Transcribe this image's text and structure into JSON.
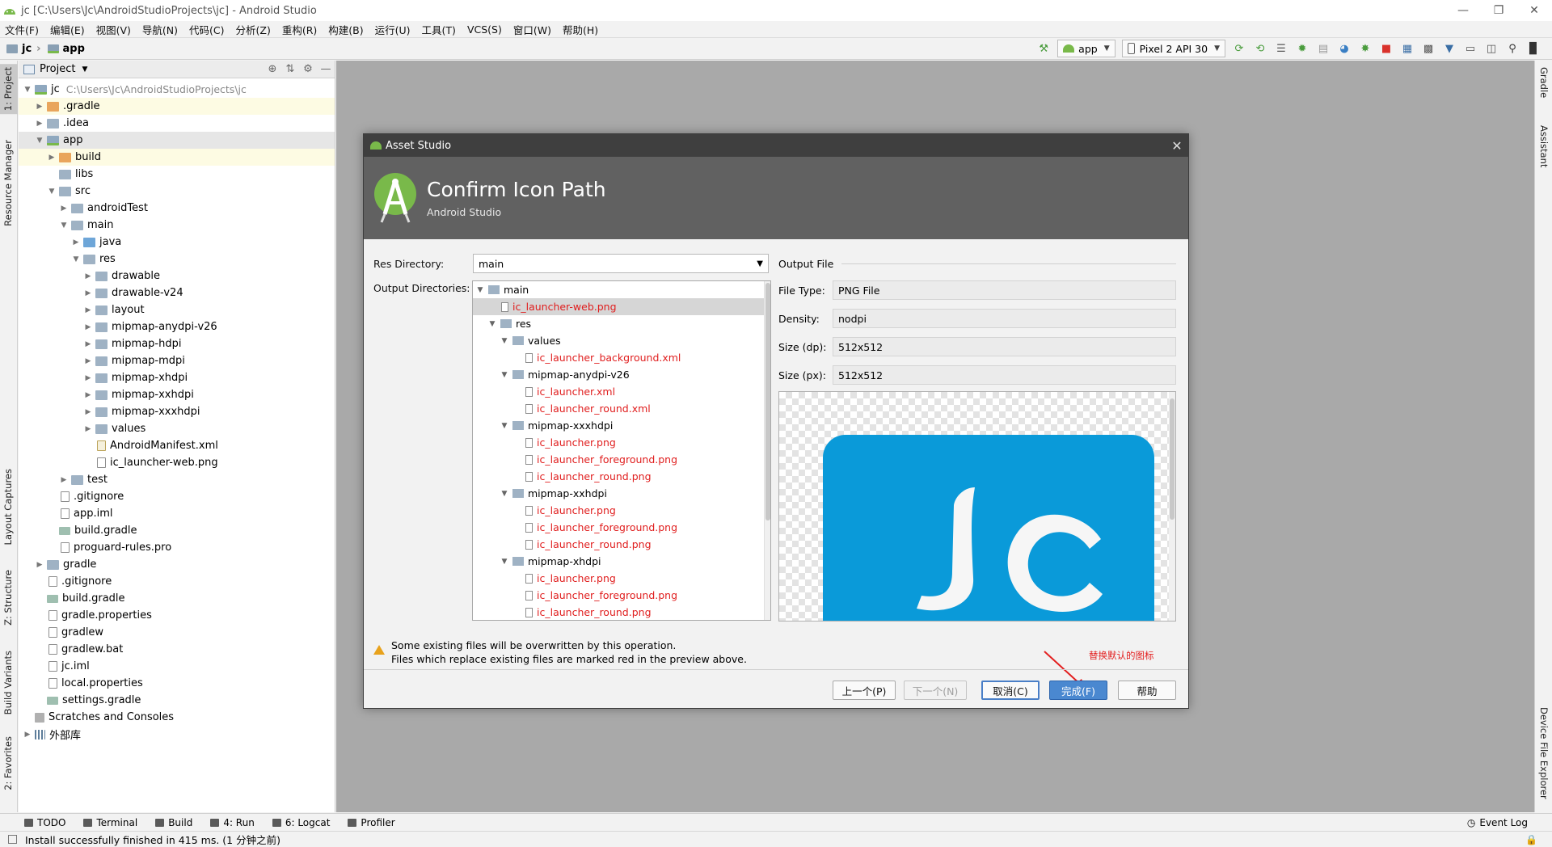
{
  "window": {
    "title": "jc [C:\\Users\\Jc\\AndroidStudioProjects\\jc] - Android Studio"
  },
  "menu": [
    "文件(F)",
    "编辑(E)",
    "视图(V)",
    "导航(N)",
    "代码(C)",
    "分析(Z)",
    "重构(R)",
    "构建(B)",
    "运行(U)",
    "工具(T)",
    "VCS(S)",
    "窗口(W)",
    "帮助(H)"
  ],
  "nav": {
    "crumb_project": "jc",
    "crumb_module": "app",
    "run_config": "app",
    "device": "Pixel 2 API 30"
  },
  "left_tabs": [
    "1: Project",
    "Resource Manager",
    "Layout Captures",
    "Z: Structure",
    "Build Variants",
    "2: Favorites"
  ],
  "right_tabs": [
    "Gradle",
    "Assistant",
    "Device File Explorer"
  ],
  "project_panel": {
    "title": "Project",
    "root_path": "C:\\Users\\Jc\\AndroidStudioProjects\\jc",
    "tree": [
      {
        "label": "jc",
        "level": 0,
        "toggle": "▼",
        "icon": "module",
        "style": ""
      },
      {
        "label": ".gradle",
        "level": 1,
        "toggle": "▶",
        "icon": "orange",
        "style": "highlight-yellow"
      },
      {
        "label": ".idea",
        "level": 1,
        "toggle": "▶",
        "icon": "folder",
        "style": ""
      },
      {
        "label": "app",
        "level": 1,
        "toggle": "▼",
        "icon": "module",
        "style": "highlight-gray"
      },
      {
        "label": "build",
        "level": 2,
        "toggle": "▶",
        "icon": "orange",
        "style": "highlight-yellow"
      },
      {
        "label": "libs",
        "level": 2,
        "toggle": "",
        "icon": "folder",
        "style": ""
      },
      {
        "label": "src",
        "level": 2,
        "toggle": "▼",
        "icon": "folder",
        "style": ""
      },
      {
        "label": "androidTest",
        "level": 3,
        "toggle": "▶",
        "icon": "folder",
        "style": ""
      },
      {
        "label": "main",
        "level": 3,
        "toggle": "▼",
        "icon": "folder",
        "style": ""
      },
      {
        "label": "java",
        "level": 4,
        "toggle": "▶",
        "icon": "blue",
        "style": ""
      },
      {
        "label": "res",
        "level": 4,
        "toggle": "▼",
        "icon": "folder",
        "style": ""
      },
      {
        "label": "drawable",
        "level": 5,
        "toggle": "▶",
        "icon": "folder",
        "style": ""
      },
      {
        "label": "drawable-v24",
        "level": 5,
        "toggle": "▶",
        "icon": "folder",
        "style": ""
      },
      {
        "label": "layout",
        "level": 5,
        "toggle": "▶",
        "icon": "folder",
        "style": ""
      },
      {
        "label": "mipmap-anydpi-v26",
        "level": 5,
        "toggle": "▶",
        "icon": "folder",
        "style": ""
      },
      {
        "label": "mipmap-hdpi",
        "level": 5,
        "toggle": "▶",
        "icon": "folder",
        "style": ""
      },
      {
        "label": "mipmap-mdpi",
        "level": 5,
        "toggle": "▶",
        "icon": "folder",
        "style": ""
      },
      {
        "label": "mipmap-xhdpi",
        "level": 5,
        "toggle": "▶",
        "icon": "folder",
        "style": ""
      },
      {
        "label": "mipmap-xxhdpi",
        "level": 5,
        "toggle": "▶",
        "icon": "folder",
        "style": ""
      },
      {
        "label": "mipmap-xxxhdpi",
        "level": 5,
        "toggle": "▶",
        "icon": "folder",
        "style": ""
      },
      {
        "label": "values",
        "level": 5,
        "toggle": "▶",
        "icon": "folder",
        "style": ""
      },
      {
        "label": "AndroidManifest.xml",
        "level": 5,
        "toggle": "",
        "icon": "xml",
        "style": ""
      },
      {
        "label": "ic_launcher-web.png",
        "level": 5,
        "toggle": "",
        "icon": "file",
        "style": ""
      },
      {
        "label": "test",
        "level": 3,
        "toggle": "▶",
        "icon": "folder",
        "style": ""
      },
      {
        "label": ".gitignore",
        "level": 2,
        "toggle": "",
        "icon": "file",
        "style": ""
      },
      {
        "label": "app.iml",
        "level": 2,
        "toggle": "",
        "icon": "file",
        "style": ""
      },
      {
        "label": "build.gradle",
        "level": 2,
        "toggle": "",
        "icon": "gradle",
        "style": ""
      },
      {
        "label": "proguard-rules.pro",
        "level": 2,
        "toggle": "",
        "icon": "file",
        "style": ""
      },
      {
        "label": "gradle",
        "level": 1,
        "toggle": "▶",
        "icon": "folder",
        "style": ""
      },
      {
        "label": ".gitignore",
        "level": 1,
        "toggle": "",
        "icon": "file",
        "style": ""
      },
      {
        "label": "build.gradle",
        "level": 1,
        "toggle": "",
        "icon": "gradle",
        "style": ""
      },
      {
        "label": "gradle.properties",
        "level": 1,
        "toggle": "",
        "icon": "file",
        "style": ""
      },
      {
        "label": "gradlew",
        "level": 1,
        "toggle": "",
        "icon": "file",
        "style": ""
      },
      {
        "label": "gradlew.bat",
        "level": 1,
        "toggle": "",
        "icon": "file",
        "style": ""
      },
      {
        "label": "jc.iml",
        "level": 1,
        "toggle": "",
        "icon": "file",
        "style": ""
      },
      {
        "label": "local.properties",
        "level": 1,
        "toggle": "",
        "icon": "file",
        "style": ""
      },
      {
        "label": "settings.gradle",
        "level": 1,
        "toggle": "",
        "icon": "gradle",
        "style": ""
      },
      {
        "label": "Scratches and Consoles",
        "level": 0,
        "toggle": "",
        "icon": "scratch",
        "style": ""
      },
      {
        "label": "外部库",
        "level": 0,
        "toggle": "▶",
        "icon": "lib",
        "style": ""
      }
    ]
  },
  "dialog": {
    "window_title": "Asset Studio",
    "heading": "Confirm Icon Path",
    "subheading": "Android Studio",
    "res_dir_label": "Res Directory:",
    "res_dir_value": "main",
    "output_dirs_label": "Output Directories:",
    "output_tree": [
      {
        "label": "main",
        "level": 0,
        "toggle": "▼",
        "kind": "folder",
        "red": false,
        "selected": false
      },
      {
        "label": "ic_launcher-web.png",
        "level": 1,
        "toggle": "",
        "kind": "file",
        "red": true,
        "selected": true
      },
      {
        "label": "res",
        "level": 1,
        "toggle": "▼",
        "kind": "folder",
        "red": false,
        "selected": false
      },
      {
        "label": "values",
        "level": 2,
        "toggle": "▼",
        "kind": "folder",
        "red": false,
        "selected": false
      },
      {
        "label": "ic_launcher_background.xml",
        "level": 3,
        "toggle": "",
        "kind": "file",
        "red": true,
        "selected": false
      },
      {
        "label": "mipmap-anydpi-v26",
        "level": 2,
        "toggle": "▼",
        "kind": "folder",
        "red": false,
        "selected": false
      },
      {
        "label": "ic_launcher.xml",
        "level": 3,
        "toggle": "",
        "kind": "file",
        "red": true,
        "selected": false
      },
      {
        "label": "ic_launcher_round.xml",
        "level": 3,
        "toggle": "",
        "kind": "file",
        "red": true,
        "selected": false
      },
      {
        "label": "mipmap-xxxhdpi",
        "level": 2,
        "toggle": "▼",
        "kind": "folder",
        "red": false,
        "selected": false
      },
      {
        "label": "ic_launcher.png",
        "level": 3,
        "toggle": "",
        "kind": "file",
        "red": true,
        "selected": false
      },
      {
        "label": "ic_launcher_foreground.png",
        "level": 3,
        "toggle": "",
        "kind": "file",
        "red": true,
        "selected": false
      },
      {
        "label": "ic_launcher_round.png",
        "level": 3,
        "toggle": "",
        "kind": "file",
        "red": true,
        "selected": false
      },
      {
        "label": "mipmap-xxhdpi",
        "level": 2,
        "toggle": "▼",
        "kind": "folder",
        "red": false,
        "selected": false
      },
      {
        "label": "ic_launcher.png",
        "level": 3,
        "toggle": "",
        "kind": "file",
        "red": true,
        "selected": false
      },
      {
        "label": "ic_launcher_foreground.png",
        "level": 3,
        "toggle": "",
        "kind": "file",
        "red": true,
        "selected": false
      },
      {
        "label": "ic_launcher_round.png",
        "level": 3,
        "toggle": "",
        "kind": "file",
        "red": true,
        "selected": false
      },
      {
        "label": "mipmap-xhdpi",
        "level": 2,
        "toggle": "▼",
        "kind": "folder",
        "red": false,
        "selected": false
      },
      {
        "label": "ic_launcher.png",
        "level": 3,
        "toggle": "",
        "kind": "file",
        "red": true,
        "selected": false
      },
      {
        "label": "ic_launcher_foreground.png",
        "level": 3,
        "toggle": "",
        "kind": "file",
        "red": true,
        "selected": false
      },
      {
        "label": "ic_launcher_round.png",
        "level": 3,
        "toggle": "",
        "kind": "file",
        "red": true,
        "selected": false
      }
    ],
    "output_file_header": "Output File",
    "file_type_label": "File Type:",
    "file_type_value": "PNG File",
    "density_label": "Density:",
    "density_value": "nodpi",
    "size_dp_label": "Size (dp):",
    "size_dp_value": "512x512",
    "size_px_label": "Size (px):",
    "size_px_value": "512x512",
    "warning_line1": "Some existing files will be overwritten by this operation.",
    "warning_line2": "Files which replace existing files are marked red in the preview above.",
    "annotation": "替换默认的图标",
    "annotation_color": "#e32020",
    "buttons": {
      "previous": "上一个(P)",
      "next": "下一个(N)",
      "cancel": "取消(C)",
      "finish": "完成(F)",
      "help": "帮助"
    },
    "preview_icon_color": "#0a9ad9"
  },
  "bottom_tabs": [
    "TODO",
    "Terminal",
    "Build",
    "4: Run",
    "6: Logcat",
    "Profiler"
  ],
  "event_log": "Event Log",
  "status": "Install successfully finished in 415 ms. (1 分钟之前)"
}
